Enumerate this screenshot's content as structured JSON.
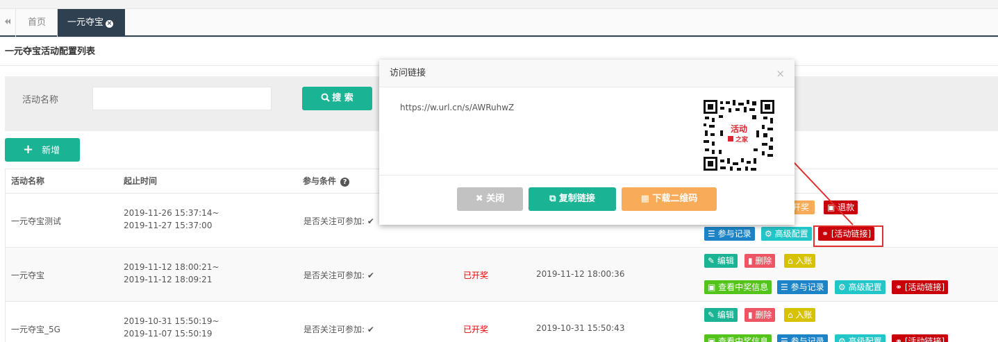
{
  "tabs": {
    "back_icon": "double-chevron-left-icon",
    "home": "首页",
    "active": "一元夺宝",
    "close_icon": "×"
  },
  "page": {
    "title": "一元夺宝活动配置列表"
  },
  "search": {
    "label": "活动名称",
    "value": "",
    "button": "搜 索"
  },
  "toolbar": {
    "add_label": "新增"
  },
  "table": {
    "headers": [
      "活动名称",
      "起止时间",
      "参与条件"
    ],
    "help_icon": "?",
    "rows": [
      {
        "name": "一元夺宝测试",
        "start": "2019-11-26 15:37:14~",
        "end": "2019-11-27 15:37:00",
        "condition": "是否关注可参加:",
        "status": "",
        "draw_time": "",
        "actions_top": [
          "开奖",
          "退款"
        ],
        "actions_bottom": [
          "参与记录",
          "高级配置",
          "[活动链接]"
        ]
      },
      {
        "name": "一元夺宝",
        "start": "2019-11-12 18:00:21~",
        "end": "2019-11-12 18:09:21",
        "condition": "是否关注可参加:",
        "status": "已开奖",
        "draw_time": "2019-11-12 18:00:36",
        "actions_top": [
          "编辑",
          "删除",
          "入账"
        ],
        "actions_bottom": [
          "查看中奖信息",
          "参与记录",
          "高级配置",
          "[活动链接]"
        ]
      },
      {
        "name": "一元夺宝_5G",
        "start": "2019-10-31 15:50:19~",
        "end": "2019-11-07 15:50:19",
        "condition": "是否关注可参加:",
        "status": "已开奖",
        "draw_time": "2019-10-31 15:50:43",
        "actions_top": [
          "编辑",
          "删除",
          "入账"
        ],
        "actions_bottom": [
          "查看中奖信息",
          "参与记录",
          "高级配置",
          "[活动链接]"
        ]
      }
    ]
  },
  "modal": {
    "title": "访问链接",
    "close": "×",
    "url": "https://w.url.cn/s/AWRuhwZ",
    "qr_logo_line1": "活动",
    "qr_logo_line2": "之家",
    "buttons": {
      "close": "关闭",
      "copy": "复制链接",
      "download": "下载二维码"
    }
  }
}
